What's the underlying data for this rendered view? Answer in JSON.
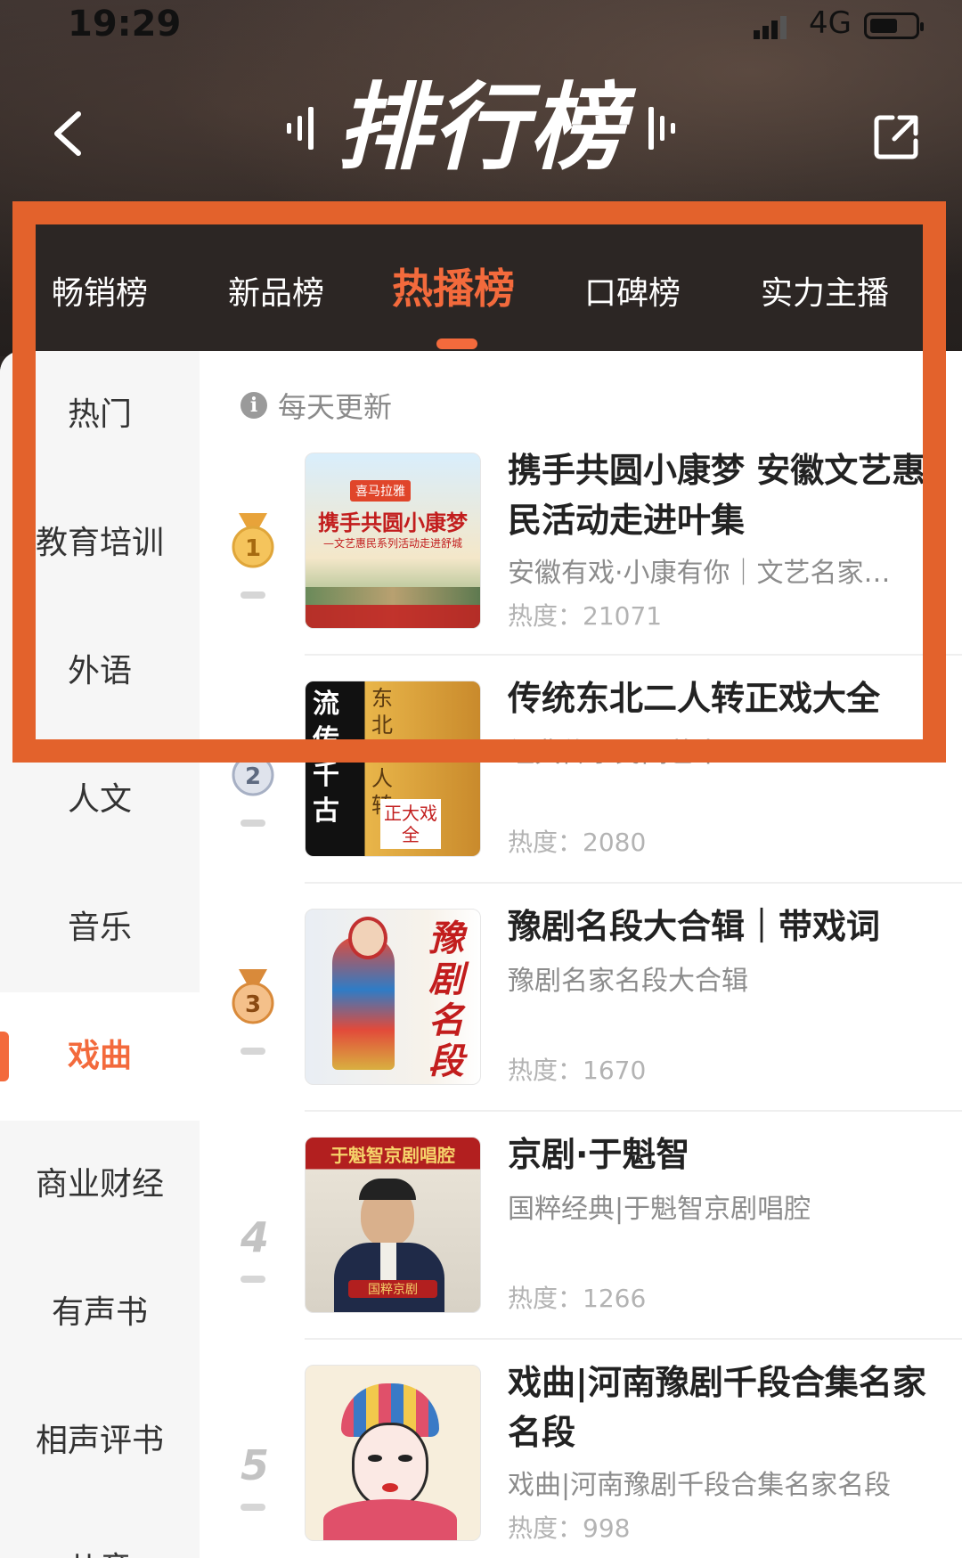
{
  "status": {
    "time": "19:29",
    "network": "4G"
  },
  "header": {
    "title": "排行榜"
  },
  "tabs": [
    {
      "label": "畅销榜"
    },
    {
      "label": "新品榜"
    },
    {
      "label": "热播榜",
      "active": true
    },
    {
      "label": "口碑榜"
    },
    {
      "label": "实力主播"
    }
  ],
  "sidebar": {
    "items": [
      {
        "label": "热门"
      },
      {
        "label": "教育培训"
      },
      {
        "label": "外语"
      },
      {
        "label": "人文"
      },
      {
        "label": "音乐"
      },
      {
        "label": "戏曲",
        "active": true
      },
      {
        "label": "商业财经"
      },
      {
        "label": "有声书"
      },
      {
        "label": "相声评书"
      },
      {
        "label": "儿童"
      }
    ]
  },
  "update_note": "每天更新",
  "list": [
    {
      "rank": "1",
      "title": "携手共圆小康梦 安徽文艺惠民活动走进叶集",
      "subtitle": "安徽有戏·小康有你｜文艺名家…",
      "heat": "热度：21071",
      "cover": {
        "logo": "喜马拉雅",
        "line1": "携手共圆小康梦",
        "line2": "—文艺惠民系列活动走进舒城"
      }
    },
    {
      "rank": "2",
      "title": "传统东北二人转正戏大全",
      "subtitle": "经典传承民间艺术",
      "heat": "热度：2080",
      "cover": {
        "line1": "流传千古",
        "line2": "东北二人转",
        "line3": "正大戏全"
      }
    },
    {
      "rank": "3",
      "title": "豫剧名段大合辑｜带戏词",
      "subtitle": "豫剧名家名段大合辑",
      "heat": "热度：1670",
      "cover": {
        "line1": "豫剧名段"
      }
    },
    {
      "rank": "4",
      "title": "京剧·于魁智",
      "subtitle": "国粹经典|于魁智京剧唱腔",
      "heat": "热度：1266",
      "cover": {
        "line1": "于魁智京剧唱腔",
        "line2": "国粹京剧"
      }
    },
    {
      "rank": "5",
      "title": "戏曲|河南豫剧千段合集名家名段",
      "subtitle": "戏曲|河南豫剧千段合集名家名段",
      "heat": "热度：998",
      "cover": {}
    }
  ],
  "colors": {
    "accent": "#f36a3c",
    "highlight": "#e3622c",
    "gold": "#e8a33a",
    "silver": "#9aa4b8",
    "bronze": "#d98a3a"
  }
}
